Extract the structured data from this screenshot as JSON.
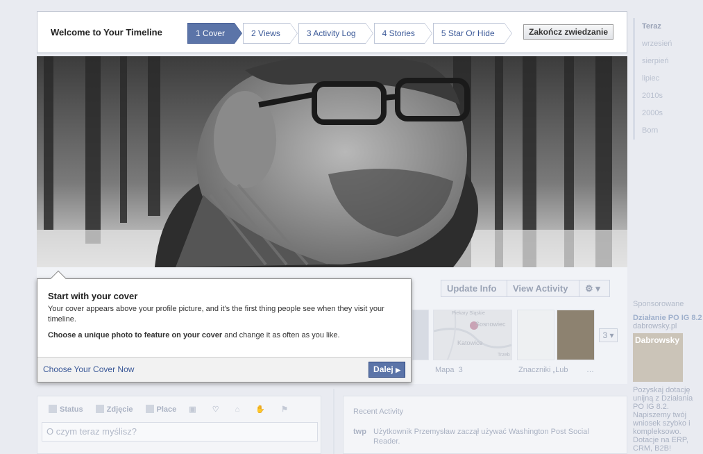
{
  "tour": {
    "title": "Welcome to Your Timeline",
    "steps": [
      "1 Cover",
      "2 Views",
      "3 Activity Log",
      "4 Stories",
      "5 Star Or Hide"
    ],
    "finish_label": "Zakończ zwiedzanie"
  },
  "timeline_nav": [
    "Teraz",
    "wrzesień",
    "sierpień",
    "lipiec",
    "2010s",
    "2000s",
    "Born"
  ],
  "profile": {
    "update_info": "Update Info",
    "view_activity": "View Activity",
    "more_count": "3",
    "map_label": "Mapa",
    "map_count": "3",
    "map_places": [
      "Piekary Śląskie",
      "Sosnowiec",
      "Katowice",
      "Trzeb"
    ],
    "tags_label": "Znaczniki „Lub",
    "ellipsis": "…"
  },
  "composer": {
    "tabs": [
      "Status",
      "Zdjęcie",
      "Place"
    ],
    "placeholder": "O czym teraz myślisz?"
  },
  "recent": {
    "title": "Recent Activity",
    "item": "Użytkownik Przemysław zaczął używać Washington Post Social Reader.",
    "badge": "twp"
  },
  "sponsor": {
    "label": "Sponsorowane",
    "ad_title": "Działanie PO IG 8.2",
    "ad_domain": "dabrowsky.pl",
    "ad_image_text": "Dabrowsky",
    "ad_body": "Pozyskaj dotację unijną z Działania PO IG 8.2. Napiszemy twój wniosek szybko i kompleksowo. Dotacje na ERP, CRM, B2B!"
  },
  "card": {
    "title": "Start with your cover",
    "body1": "Your cover appears above your profile picture, and it's the first thing people see when they visit your timeline.",
    "body2_bold": "Choose a unique photo to feature on your cover",
    "body2_rest": " and change it as often as you like.",
    "choose_link": "Choose Your Cover Now",
    "next_label": "Dalej"
  }
}
